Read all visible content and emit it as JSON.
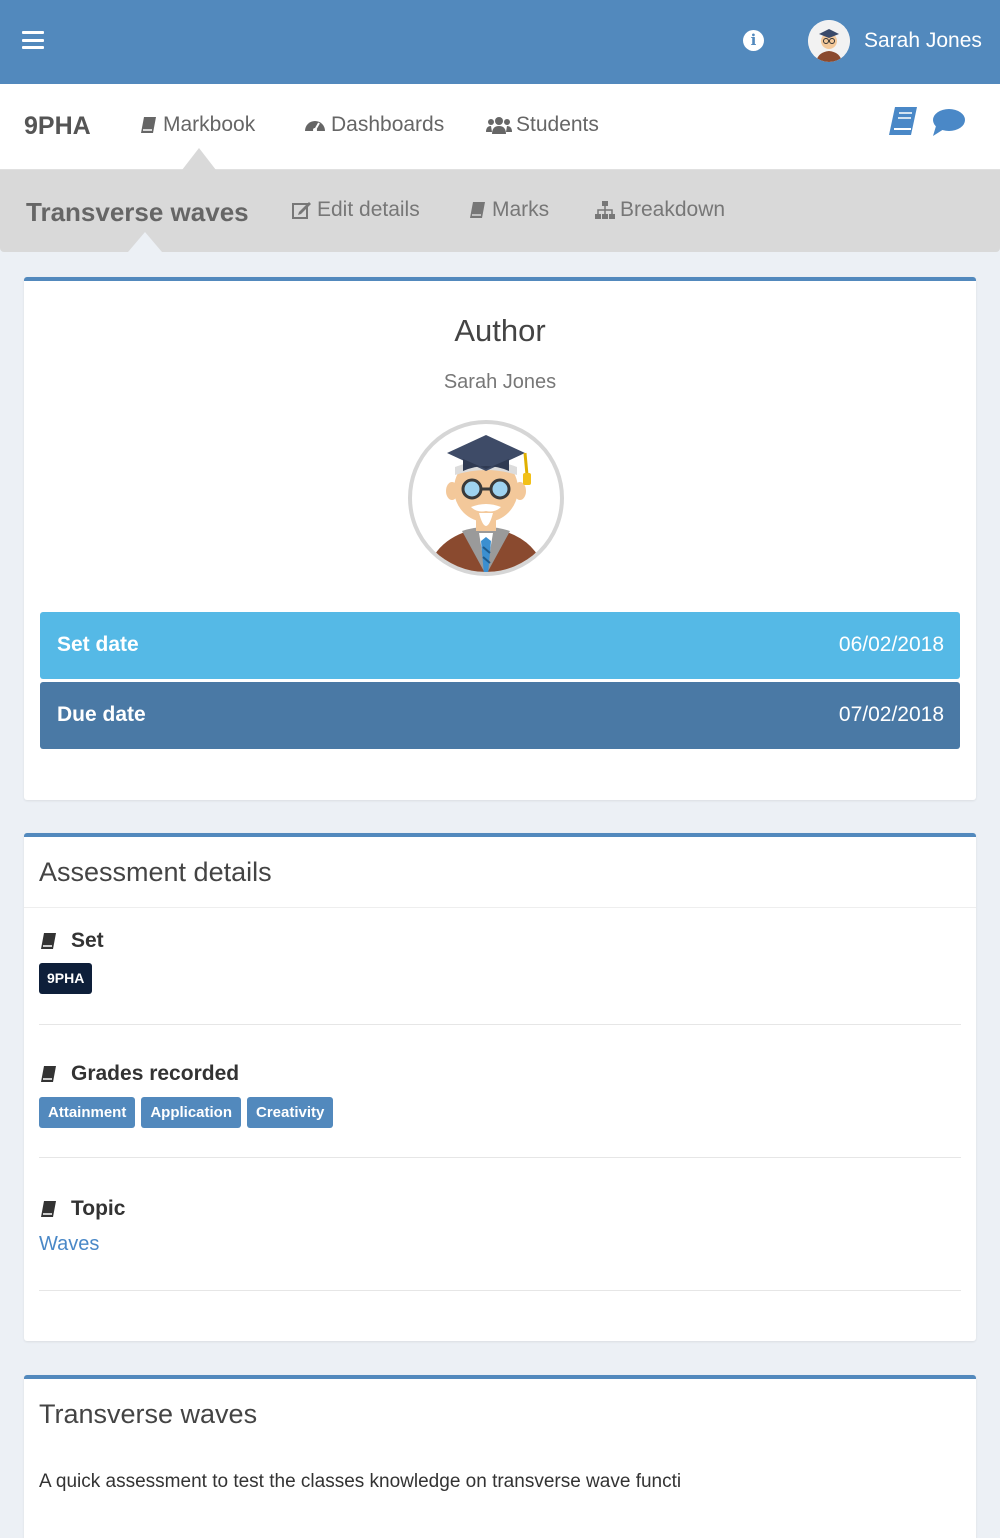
{
  "topbar": {
    "user_name": "Sarah Jones",
    "menu_icon": "hamburger-menu-icon",
    "info_icon": "info-circle-icon",
    "brand_color": "#5289bd"
  },
  "nav": {
    "class_code": "9PHA",
    "links": [
      {
        "label": "Markbook",
        "icon": "book-icon"
      },
      {
        "label": "Dashboards",
        "icon": "dashboard-icon"
      },
      {
        "label": "Students",
        "icon": "users-icon"
      }
    ],
    "right_icons": [
      "book-icon",
      "chat-bubble-icon"
    ]
  },
  "subnav": {
    "title": "Transverse waves",
    "links": [
      {
        "label": "Edit details",
        "icon": "edit-icon"
      },
      {
        "label": "Marks",
        "icon": "book-icon"
      },
      {
        "label": "Breakdown",
        "icon": "sitemap-icon"
      }
    ]
  },
  "author_card": {
    "heading": "Author",
    "name": "Sarah Jones",
    "set_date_label": "Set date",
    "set_date_value": "06/02/2018",
    "due_date_label": "Due date",
    "due_date_value": "07/02/2018",
    "set_color": "#55b9e6",
    "due_color": "#4a79a5"
  },
  "details_card": {
    "heading": "Assessment details",
    "set_label": "Set",
    "set_tag": "9PHA",
    "grades_label": "Grades recorded",
    "grades": [
      "Attainment",
      "Application",
      "Creativity"
    ],
    "topic_label": "Topic",
    "topic_value": "Waves"
  },
  "description_card": {
    "heading": "Transverse waves",
    "text": "A quick assessment to test the classes knowledge on transverse wave functi"
  }
}
